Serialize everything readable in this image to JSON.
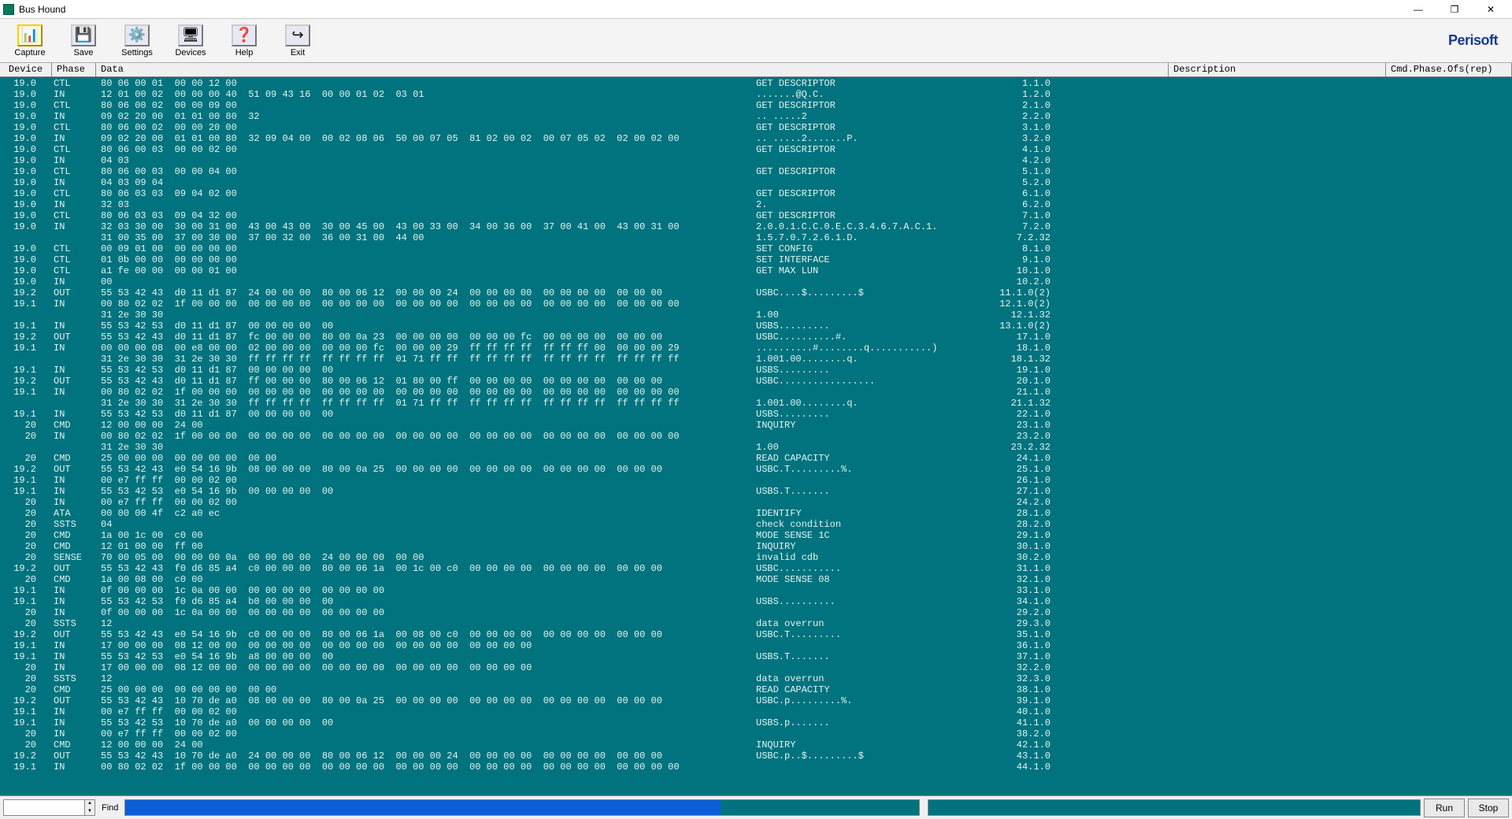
{
  "window": {
    "title": "Bus Hound"
  },
  "toolbar": {
    "items": [
      {
        "label": "Capture",
        "icon": "📊"
      },
      {
        "label": "Save",
        "icon": "💾"
      },
      {
        "label": "Settings",
        "icon": "⚙️"
      },
      {
        "label": "Devices",
        "icon": "🖥"
      },
      {
        "label": "Help",
        "icon": "❓"
      },
      {
        "label": "Exit",
        "icon": "↪"
      }
    ],
    "brand": "Perisoft"
  },
  "columns": {
    "device": "Device",
    "phase": "Phase",
    "data": "Data",
    "description": "Description",
    "cpo": "Cmd.Phase.Ofs(rep)"
  },
  "rows": [
    {
      "dev": "19.0",
      "phase": "CTL",
      "data": "80 06 00 01  00 00 12 00",
      "desc": "GET DESCRIPTOR",
      "cpo": "1.1.0"
    },
    {
      "dev": "19.0",
      "phase": "IN",
      "data": "12 01 00 02  00 00 00 40  51 09 43 16  00 00 01 02  03 01",
      "desc": ".......@Q.C.",
      "cpo": "1.2.0"
    },
    {
      "dev": "19.0",
      "phase": "CTL",
      "data": "80 06 00 02  00 00 09 00",
      "desc": "GET DESCRIPTOR",
      "cpo": "2.1.0"
    },
    {
      "dev": "19.0",
      "phase": "IN",
      "data": "09 02 20 00  01 01 00 80  32",
      "desc": ".. .....2",
      "cpo": "2.2.0"
    },
    {
      "dev": "19.0",
      "phase": "CTL",
      "data": "80 06 00 02  00 00 20 00",
      "desc": "GET DESCRIPTOR",
      "cpo": "3.1.0"
    },
    {
      "dev": "19.0",
      "phase": "IN",
      "data": "09 02 20 00  01 01 00 80  32 09 04 00  00 02 08 06  50 00 07 05  81 02 00 02  00 07 05 02  02 00 02 00",
      "desc": ".. .....2.......P.",
      "cpo": "3.2.0"
    },
    {
      "dev": "19.0",
      "phase": "CTL",
      "data": "80 06 00 03  00 00 02 00",
      "desc": "GET DESCRIPTOR",
      "cpo": "4.1.0"
    },
    {
      "dev": "19.0",
      "phase": "IN",
      "data": "04 03",
      "desc": "",
      "cpo": "4.2.0"
    },
    {
      "dev": "19.0",
      "phase": "CTL",
      "data": "80 06 00 03  00 00 04 00",
      "desc": "GET DESCRIPTOR",
      "cpo": "5.1.0"
    },
    {
      "dev": "19.0",
      "phase": "IN",
      "data": "04 03 09 04",
      "desc": "",
      "cpo": "5.2.0"
    },
    {
      "dev": "19.0",
      "phase": "CTL",
      "data": "80 06 03 03  09 04 02 00",
      "desc": "GET DESCRIPTOR",
      "cpo": "6.1.0"
    },
    {
      "dev": "19.0",
      "phase": "IN",
      "data": "32 03",
      "desc": "2.",
      "cpo": "6.2.0"
    },
    {
      "dev": "19.0",
      "phase": "CTL",
      "data": "80 06 03 03  09 04 32 00",
      "desc": "GET DESCRIPTOR",
      "cpo": "7.1.0"
    },
    {
      "dev": "19.0",
      "phase": "IN",
      "data": "32 03 30 00  30 00 31 00  43 00 43 00  30 00 45 00  43 00 33 00  34 00 36 00  37 00 41 00  43 00 31 00",
      "desc": "2.0.0.1.C.C.0.E.C.3.4.6.7.A.C.1.",
      "cpo": "7.2.0"
    },
    {
      "dev": "",
      "phase": "",
      "data": "31 00 35 00  37 00 30 00  37 00 32 00  36 00 31 00  44 00",
      "desc": "1.5.7.0.7.2.6.1.D.",
      "cpo": "7.2.32"
    },
    {
      "dev": "19.0",
      "phase": "CTL",
      "data": "00 09 01 00  00 00 00 00",
      "desc": "SET CONFIG",
      "cpo": "8.1.0"
    },
    {
      "dev": "19.0",
      "phase": "CTL",
      "data": "01 0b 00 00  00 00 00 00",
      "desc": "SET INTERFACE",
      "cpo": "9.1.0"
    },
    {
      "dev": "19.0",
      "phase": "CTL",
      "data": "a1 fe 00 00  00 00 01 00",
      "desc": "GET MAX LUN",
      "cpo": "10.1.0"
    },
    {
      "dev": "19.0",
      "phase": "IN",
      "data": "00",
      "desc": "",
      "cpo": "10.2.0"
    },
    {
      "dev": "19.2",
      "phase": "OUT",
      "data": "55 53 42 43  d0 11 d1 87  24 00 00 00  80 00 06 12  00 00 00 24  00 00 00 00  00 00 00 00  00 00 00",
      "desc": "USBC....$.........$",
      "cpo": "11.1.0(2)"
    },
    {
      "dev": "19.1",
      "phase": "IN",
      "data": "00 80 02 02  1f 00 00 00  00 00 00 00  00 00 00 00  00 00 00 00  00 00 00 00  00 00 00 00  00 00 00 00",
      "desc": "",
      "cpo": "12.1.0(2)"
    },
    {
      "dev": "",
      "phase": "",
      "data": "31 2e 30 30",
      "desc": "1.00",
      "cpo": "12.1.32"
    },
    {
      "dev": "19.1",
      "phase": "IN",
      "data": "55 53 42 53  d0 11 d1 87  00 00 00 00  00",
      "desc": "USBS.........",
      "cpo": "13.1.0(2)"
    },
    {
      "dev": "19.2",
      "phase": "OUT",
      "data": "55 53 42 43  d0 11 d1 87  fc 00 00 00  80 00 0a 23  00 00 00 00  00 00 00 fc  00 00 00 00  00 00 00",
      "desc": "USBC..........#.",
      "cpo": "17.1.0"
    },
    {
      "dev": "19.1",
      "phase": "IN",
      "data": "00 00 00 08  00 e8 00 00  02 00 00 00  00 00 00 fc  00 00 00 29  ff ff ff ff  ff ff ff 00  00 00 00 29",
      "desc": "..........#........q...........)",
      "cpo": "18.1.0"
    },
    {
      "dev": "",
      "phase": "",
      "data": "31 2e 30 30  31 2e 30 30  ff ff ff ff  ff ff ff ff  01 71 ff ff  ff ff ff ff  ff ff ff ff  ff ff ff ff",
      "desc": "1.001.00........q.",
      "cpo": "18.1.32"
    },
    {
      "dev": "19.1",
      "phase": "IN",
      "data": "55 53 42 53  d0 11 d1 87  00 00 00 00  00",
      "desc": "USBS.........",
      "cpo": "19.1.0"
    },
    {
      "dev": "19.2",
      "phase": "OUT",
      "data": "55 53 42 43  d0 11 d1 87  ff 00 00 00  80 00 06 12  01 80 00 ff  00 00 00 00  00 00 00 00  00 00 00",
      "desc": "USBC.................",
      "cpo": "20.1.0"
    },
    {
      "dev": "19.1",
      "phase": "IN",
      "data": "00 80 02 02  1f 00 00 00  00 00 00 00  00 00 00 00  00 00 00 00  00 00 00 00  00 00 00 00  00 00 00 00",
      "desc": "",
      "cpo": "21.1.0"
    },
    {
      "dev": "",
      "phase": "",
      "data": "31 2e 30 30  31 2e 30 30  ff ff ff ff  ff ff ff ff  01 71 ff ff  ff ff ff ff  ff ff ff ff  ff ff ff ff",
      "desc": "1.001.00........q.",
      "cpo": "21.1.32"
    },
    {
      "dev": "19.1",
      "phase": "IN",
      "data": "55 53 42 53  d0 11 d1 87  00 00 00 00  00",
      "desc": "USBS.........",
      "cpo": "22.1.0"
    },
    {
      "dev": "20",
      "phase": "CMD",
      "data": "12 00 00 00  24 00",
      "desc": "INQUIRY",
      "cpo": "23.1.0"
    },
    {
      "dev": "20",
      "phase": "IN",
      "data": "00 80 02 02  1f 00 00 00  00 00 00 00  00 00 00 00  00 00 00 00  00 00 00 00  00 00 00 00  00 00 00 00",
      "desc": "",
      "cpo": "23.2.0"
    },
    {
      "dev": "",
      "phase": "",
      "data": "31 2e 30 30",
      "desc": "1.00",
      "cpo": "23.2.32"
    },
    {
      "dev": "20",
      "phase": "CMD",
      "data": "25 00 00 00  00 00 00 00  00 00",
      "desc": "READ CAPACITY",
      "cpo": "24.1.0"
    },
    {
      "dev": "19.2",
      "phase": "OUT",
      "data": "55 53 42 43  e0 54 16 9b  08 00 00 00  80 00 0a 25  00 00 00 00  00 00 00 00  00 00 00 00  00 00 00",
      "desc": "USBC.T.........%.",
      "cpo": "25.1.0"
    },
    {
      "dev": "19.1",
      "phase": "IN",
      "data": "00 e7 ff ff  00 00 02 00",
      "desc": "",
      "cpo": "26.1.0"
    },
    {
      "dev": "19.1",
      "phase": "IN",
      "data": "55 53 42 53  e0 54 16 9b  00 00 00 00  00",
      "desc": "USBS.T.......",
      "cpo": "27.1.0"
    },
    {
      "dev": "20",
      "phase": "IN",
      "data": "00 e7 ff ff  00 00 02 00",
      "desc": "",
      "cpo": "24.2.0"
    },
    {
      "dev": "20",
      "phase": "ATA",
      "data": "00 00 00 4f  c2 a0 ec",
      "desc": "IDENTIFY",
      "cpo": "28.1.0"
    },
    {
      "dev": "20",
      "phase": "SSTS",
      "data": "04",
      "desc": "check condition",
      "cpo": "28.2.0"
    },
    {
      "dev": "20",
      "phase": "CMD",
      "data": "1a 00 1c 00  c0 00",
      "desc": "MODE SENSE 1C",
      "cpo": "29.1.0"
    },
    {
      "dev": "20",
      "phase": "CMD",
      "data": "12 01 00 00  ff 00",
      "desc": "INQUIRY",
      "cpo": "30.1.0"
    },
    {
      "dev": "20",
      "phase": "SENSE",
      "data": "70 00 05 00  00 00 00 0a  00 00 00 00  24 00 00 00  00 00",
      "desc": "invalid cdb",
      "cpo": "30.2.0"
    },
    {
      "dev": "19.2",
      "phase": "OUT",
      "data": "55 53 42 43  f0 d6 85 a4  c0 00 00 00  80 00 06 1a  00 1c 00 c0  00 00 00 00  00 00 00 00  00 00 00",
      "desc": "USBC...........",
      "cpo": "31.1.0"
    },
    {
      "dev": "20",
      "phase": "CMD",
      "data": "1a 00 08 00  c0 00",
      "desc": "MODE SENSE 08",
      "cpo": "32.1.0"
    },
    {
      "dev": "19.1",
      "phase": "IN",
      "data": "0f 00 00 00  1c 0a 00 00  00 00 00 00  00 00 00 00",
      "desc": "",
      "cpo": "33.1.0"
    },
    {
      "dev": "19.1",
      "phase": "IN",
      "data": "55 53 42 53  f0 d6 85 a4  b0 00 00 00  00",
      "desc": "USBS..........",
      "cpo": "34.1.0"
    },
    {
      "dev": "20",
      "phase": "IN",
      "data": "0f 00 00 00  1c 0a 00 00  00 00 00 00  00 00 00 00",
      "desc": "",
      "cpo": "29.2.0"
    },
    {
      "dev": "20",
      "phase": "SSTS",
      "data": "12",
      "desc": "data overrun",
      "cpo": "29.3.0"
    },
    {
      "dev": "19.2",
      "phase": "OUT",
      "data": "55 53 42 43  e0 54 16 9b  c0 00 00 00  80 00 06 1a  00 08 00 c0  00 00 00 00  00 00 00 00  00 00 00",
      "desc": "USBC.T.........",
      "cpo": "35.1.0"
    },
    {
      "dev": "19.1",
      "phase": "IN",
      "data": "17 00 00 00  08 12 00 00  00 00 00 00  00 00 00 00  00 00 00 00  00 00 00 00",
      "desc": "",
      "cpo": "36.1.0"
    },
    {
      "dev": "19.1",
      "phase": "IN",
      "data": "55 53 42 53  e0 54 16 9b  a8 00 00 00  00",
      "desc": "USBS.T.......",
      "cpo": "37.1.0"
    },
    {
      "dev": "20",
      "phase": "IN",
      "data": "17 00 00 00  08 12 00 00  00 00 00 00  00 00 00 00  00 00 00 00  00 00 00 00",
      "desc": "",
      "cpo": "32.2.0"
    },
    {
      "dev": "20",
      "phase": "SSTS",
      "data": "12",
      "desc": "data overrun",
      "cpo": "32.3.0"
    },
    {
      "dev": "20",
      "phase": "CMD",
      "data": "25 00 00 00  00 00 00 00  00 00",
      "desc": "READ CAPACITY",
      "cpo": "38.1.0"
    },
    {
      "dev": "19.2",
      "phase": "OUT",
      "data": "55 53 42 43  10 70 de a0  08 00 00 00  80 00 0a 25  00 00 00 00  00 00 00 00  00 00 00 00  00 00 00",
      "desc": "USBC.p.........%.",
      "cpo": "39.1.0"
    },
    {
      "dev": "19.1",
      "phase": "IN",
      "data": "00 e7 ff ff  00 00 02 00",
      "desc": "",
      "cpo": "40.1.0"
    },
    {
      "dev": "19.1",
      "phase": "IN",
      "data": "55 53 42 53  10 70 de a0  00 00 00 00  00",
      "desc": "USBS.p.......",
      "cpo": "41.1.0"
    },
    {
      "dev": "20",
      "phase": "IN",
      "data": "00 e7 ff ff  00 00 02 00",
      "desc": "",
      "cpo": "38.2.0"
    },
    {
      "dev": "20",
      "phase": "CMD",
      "data": "12 00 00 00  24 00",
      "desc": "INQUIRY",
      "cpo": "42.1.0"
    },
    {
      "dev": "19.2",
      "phase": "OUT",
      "data": "55 53 42 43  10 70 de a0  24 00 00 00  80 00 06 12  00 00 00 24  00 00 00 00  00 00 00 00  00 00 00",
      "desc": "USBC.p..$.........$",
      "cpo": "43.1.0"
    },
    {
      "dev": "19.1",
      "phase": "IN",
      "data": "00 80 02 02  1f 00 00 00  00 00 00 00  00 00 00 00  00 00 00 00  00 00 00 00  00 00 00 00  00 00 00 00",
      "desc": "",
      "cpo": "44.1.0"
    }
  ],
  "footer": {
    "find_label": "Find",
    "progress_pct": 75,
    "run_label": "Run",
    "stop_label": "Stop"
  }
}
